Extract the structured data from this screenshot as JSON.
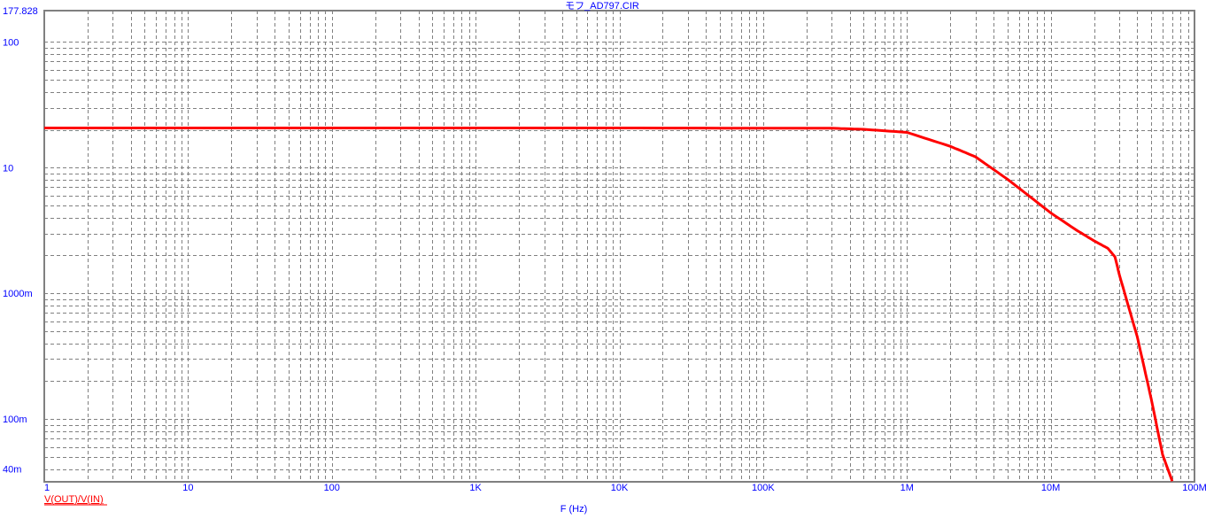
{
  "chart_data": {
    "type": "line",
    "title": "モフ_AD797.CIR",
    "xlabel": "F (Hz)",
    "ylabel": "",
    "xscale": "log",
    "yscale": "log",
    "xlim": [
      1,
      100000000
    ],
    "ylim": [
      0.0316228,
      177.828
    ],
    "grid": true,
    "x_tick_labels": [
      {
        "value": 1,
        "label": "1"
      },
      {
        "value": 10,
        "label": "10"
      },
      {
        "value": 100,
        "label": "100"
      },
      {
        "value": 1000,
        "label": "1K"
      },
      {
        "value": 10000,
        "label": "10K"
      },
      {
        "value": 100000,
        "label": "100K"
      },
      {
        "value": 1000000,
        "label": "1M"
      },
      {
        "value": 10000000,
        "label": "10M"
      },
      {
        "value": 100000000,
        "label": "100M"
      }
    ],
    "y_tick_labels": [
      {
        "value": 177.828,
        "label": "177.828"
      },
      {
        "value": 100,
        "label": "100"
      },
      {
        "value": 10,
        "label": "10"
      },
      {
        "value": 1,
        "label": "1000m"
      },
      {
        "value": 0.1,
        "label": "100m"
      },
      {
        "value": 0.04,
        "label": "40m"
      }
    ],
    "legend_placement": "bottom-left",
    "series": [
      {
        "name": "V(OUT)/V(IN)",
        "color": "#ff0000",
        "x": [
          1,
          10000,
          300000,
          500000,
          1000000,
          2000000,
          3000000,
          5000000,
          10000000,
          15000000,
          20000000,
          25000000,
          28000000,
          30000000,
          40000000,
          50000000,
          60000000,
          70000000
        ],
        "y": [
          20.7,
          20.7,
          20.6,
          20.2,
          19.1,
          14.8,
          12.2,
          8.1,
          4.37,
          3.2,
          2.62,
          2.28,
          1.95,
          1.41,
          0.45,
          0.145,
          0.052,
          0.032
        ]
      }
    ]
  }
}
